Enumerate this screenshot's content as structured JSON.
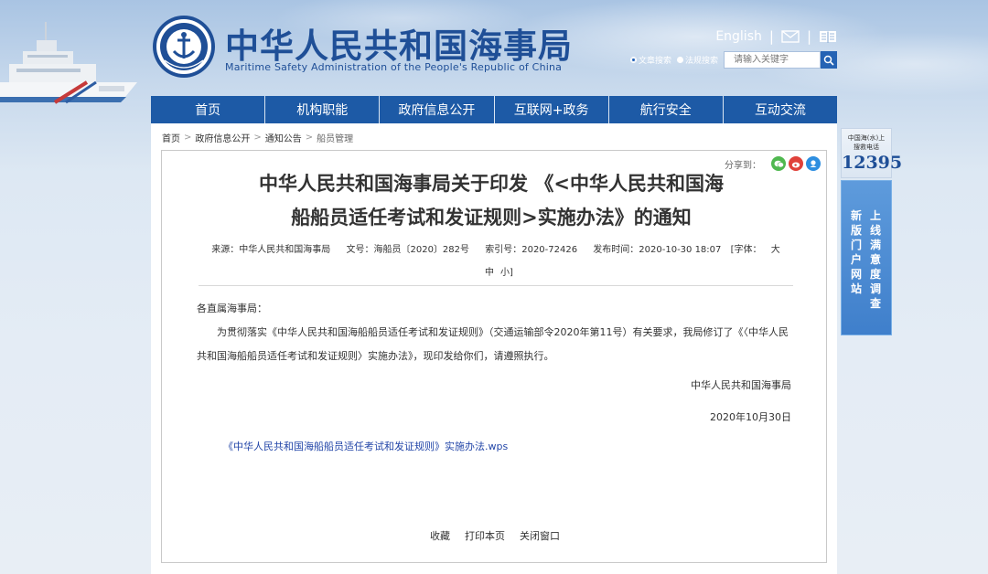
{
  "header": {
    "title_cn": "中华人民共和国海事局",
    "title_en": "Maritime Safety Administration of the People's Republic of China",
    "english_label": "English",
    "search": {
      "options": [
        "文章搜索",
        "法规搜索"
      ],
      "placeholder": "请输入关键字"
    }
  },
  "nav": {
    "items": [
      "首页",
      "机构职能",
      "政府信息公开",
      "互联网+政务",
      "航行安全",
      "互动交流"
    ]
  },
  "breadcrumb": [
    "首页",
    "政府信息公开",
    "通知公告",
    "船员管理"
  ],
  "share": {
    "label": "分享到："
  },
  "article": {
    "title_line1": "中华人民共和国海事局关于印发 《<中华人民共和国海",
    "title_line2": "船船员适任考试和发证规则>实施办法》的通知",
    "meta": {
      "source": "来源：中华人民共和国海事局",
      "doc_no": "文号：海船员〔2020〕282号",
      "index_no": "索引号：2020-72426",
      "published": "发布时间：2020-10-30 18:07",
      "font_open": "[字体：",
      "font_large": "大",
      "font_medium": "中",
      "font_small": "小",
      "font_close": "]"
    },
    "salutation": "各直属海事局：",
    "body": "为贯彻落实《中华人民共和国海船船员适任考试和发证规则》（交通运输部令2020年第11号）有关要求，我局修订了《〈中华人民共和国海船船员适任考试和发证规则〉实施办法》，现印发给你们，请遵照执行。",
    "signature": "中华人民共和国海事局",
    "date": "2020年10月30日",
    "attachment": "《中华人民共和国海船船员适任考试和发证规则》实施办法.wps"
  },
  "footer": {
    "favorite": "收藏",
    "print": "打印本页",
    "close": "关闭窗口"
  },
  "sidebar": {
    "hotline_caption": "中国海(水)上\n搜救电话",
    "hotline_number": "12395",
    "survey_col1": "新版门户网站",
    "survey_col2": "上线满意度调查"
  },
  "colors": {
    "brand_blue": "#1d5aa6",
    "title_blue": "#1f4f97",
    "link_blue": "#2346a8"
  }
}
